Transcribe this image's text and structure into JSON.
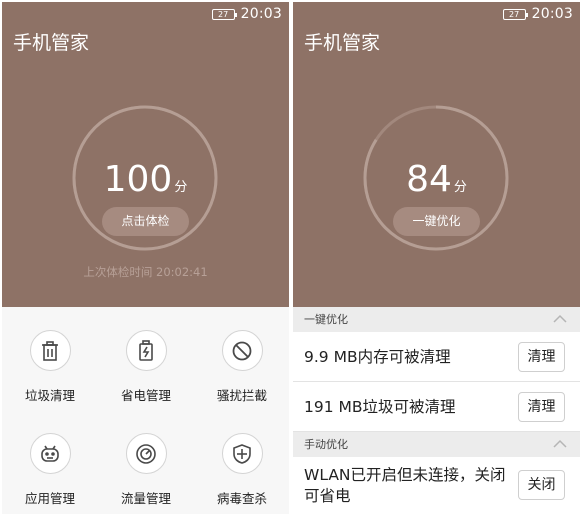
{
  "left_screen": {
    "status": {
      "battery": "27",
      "time": "20:03"
    },
    "title": "手机管家",
    "score": {
      "value": 100,
      "text": "100",
      "unit": "分"
    },
    "check_button": "点击体检",
    "last_check": "上次体检时间  20:02:41",
    "tools": [
      {
        "label": "垃圾清理",
        "icon": "trash-icon"
      },
      {
        "label": "省电管理",
        "icon": "battery-saver-icon"
      },
      {
        "label": "骚扰拦截",
        "icon": "block-icon"
      },
      {
        "label": "应用管理",
        "icon": "android-icon"
      },
      {
        "label": "流量管理",
        "icon": "speedometer-icon"
      },
      {
        "label": "病毒查杀",
        "icon": "shield-icon"
      }
    ]
  },
  "right_screen": {
    "status": {
      "battery": "27",
      "time": "20:03"
    },
    "title": "手机管家",
    "score": {
      "value": 84,
      "text": "84",
      "unit": "分"
    },
    "optimize_button": "一键优化",
    "sections": [
      {
        "header": "一键优化",
        "items": [
          {
            "text": "9.9 MB内存可被清理",
            "action": "清理"
          },
          {
            "text": "191 MB垃圾可被清理",
            "action": "清理"
          }
        ]
      },
      {
        "header": "手动优化",
        "items": [
          {
            "text": "WLAN已开启但未连接，关闭可省电",
            "action": "关闭"
          }
        ]
      }
    ]
  },
  "colors": {
    "hero_background": "#8e7266",
    "ring_track": "#a2887d",
    "ring_progress": "#b59e94",
    "pill": "#a68b80",
    "grid_background": "#f7f7f7",
    "section_header": "#ececec"
  }
}
